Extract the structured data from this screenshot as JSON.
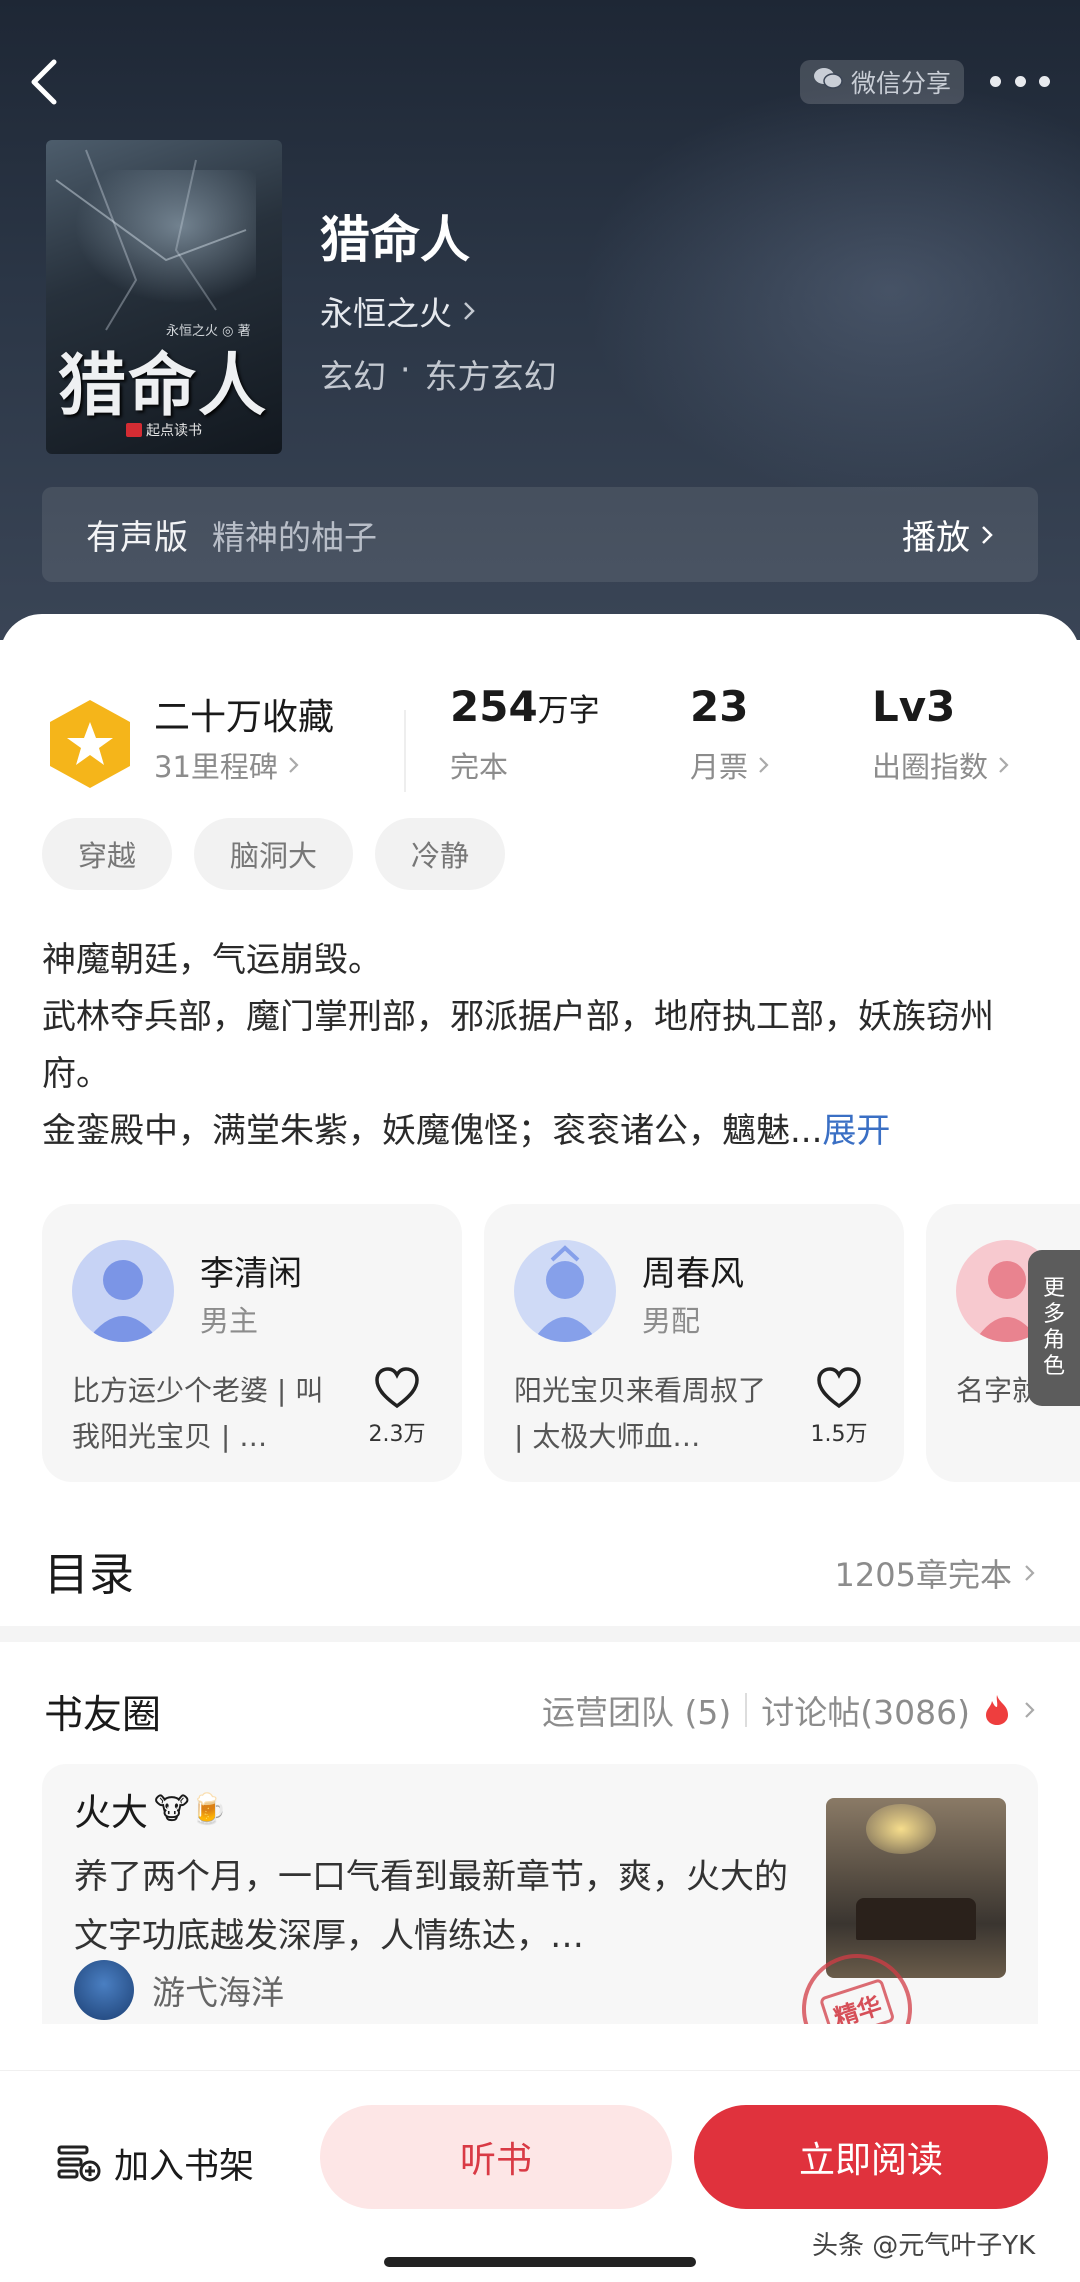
{
  "header": {
    "share_label": "微信分享",
    "cover": {
      "title": "猎命人",
      "author": "永恒之火 ◎ 著",
      "brand": "起点读书"
    },
    "title": "猎命人",
    "author": "永恒之火",
    "genre": [
      "玄幻",
      "·",
      "东方玄幻"
    ],
    "audio": {
      "label": "有声版",
      "narrator": "精神的柚子",
      "action": "播放"
    }
  },
  "stats": {
    "collect_main": "二十万收藏",
    "collect_sub": "31里程碑",
    "words_num": "254",
    "words_unit": "万字",
    "words_sub": "完本",
    "tickets_num": "23",
    "tickets_sub": "月票",
    "index_num": "Lv3",
    "index_sub": "出圈指数"
  },
  "tags": [
    "穿越",
    "脑洞大",
    "冷静"
  ],
  "synopsis": {
    "lines": [
      "神魔朝廷，气运崩毁。",
      "武林夺兵部，魔门掌刑部，邪派据户部，地府执工部，妖族窃州府。",
      "金銮殿中，满堂朱紫，妖魔傀怪；衮衮诸公，魑魅..."
    ],
    "expand": "展开"
  },
  "characters": [
    {
      "name": "李清闲",
      "role": "男主",
      "desc": "比方运少个老婆 | 叫我阳光宝贝 | …",
      "likes": "2.3万"
    },
    {
      "name": "周春风",
      "role": "男配",
      "desc": "阳光宝贝来看周叔了 | 太极大师血…",
      "likes": "1.5万"
    },
    {
      "name": "",
      "role": "",
      "desc": "名字就有 | 这门亲事",
      "likes": ""
    }
  ],
  "more_roles": [
    "更",
    "多",
    "角",
    "色"
  ],
  "toc": {
    "title": "目录",
    "status": "1205章完本"
  },
  "circle": {
    "title": "书友圈",
    "ops": "运营团队 (5)",
    "posts": "讨论帖(3086)",
    "post": {
      "user": "火大",
      "emoji": "🐮🍺",
      "text": "养了两个月，一口气看到最新章节，爽，火大的文字功底越发深厚，人情练达，…",
      "stamp": "精华",
      "reply_user": "游弋海洋"
    }
  },
  "bottom": {
    "shelf": "加入书架",
    "listen": "听书",
    "read": "立即阅读"
  },
  "watermark": "头条 @元气叶子YK",
  "colors": {
    "accent": "#e0323d",
    "accent_light": "#fde6e6",
    "link": "#3a6fc4",
    "medal": "#f5b51a"
  },
  "icons": [
    "back-icon",
    "wechat-icon",
    "more-icon",
    "chevron-right-icon",
    "medal-star-icon",
    "heart-icon",
    "fire-icon",
    "bookshelf-add-icon"
  ]
}
